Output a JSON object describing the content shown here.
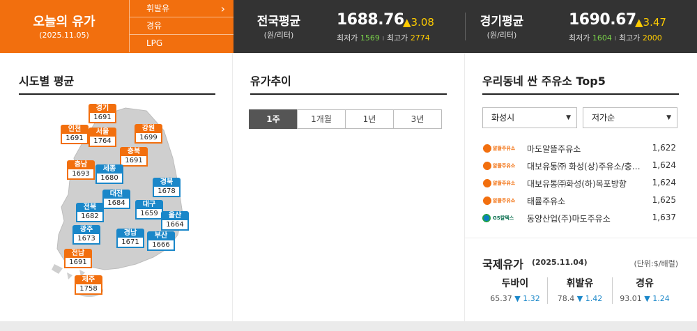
{
  "today": {
    "title": "오늘의 유가",
    "date": "(2025.11.05)"
  },
  "fuel_tabs": [
    "휘발유",
    "경유",
    "LPG"
  ],
  "national": {
    "name": "전국평균",
    "unit": "(원/리터)",
    "price": "1688.76",
    "change": "▲3.08",
    "min_label": "최저가",
    "min": "1569",
    "max_label": "최고가",
    "max": "2774"
  },
  "gyeonggi": {
    "name": "경기평균",
    "unit": "(원/리터)",
    "price": "1690.67",
    "change": "▲3.47",
    "min_label": "최저가",
    "min": "1604",
    "max_label": "최고가",
    "max": "2000"
  },
  "regional": {
    "title": "시도별 평균",
    "regions": [
      {
        "name": "경기",
        "value": "1691",
        "color": "orange"
      },
      {
        "name": "인천",
        "value": "1691",
        "color": "orange"
      },
      {
        "name": "서울",
        "value": "1764",
        "color": "orange"
      },
      {
        "name": "강원",
        "value": "1699",
        "color": "orange"
      },
      {
        "name": "충북",
        "value": "1691",
        "color": "orange"
      },
      {
        "name": "충남",
        "value": "1693",
        "color": "orange"
      },
      {
        "name": "세종",
        "value": "1680",
        "color": "blue"
      },
      {
        "name": "경북",
        "value": "1678",
        "color": "blue"
      },
      {
        "name": "대전",
        "value": "1684",
        "color": "blue"
      },
      {
        "name": "전북",
        "value": "1682",
        "color": "blue"
      },
      {
        "name": "대구",
        "value": "1659",
        "color": "blue"
      },
      {
        "name": "울산",
        "value": "1664",
        "color": "blue"
      },
      {
        "name": "광주",
        "value": "1673",
        "color": "blue"
      },
      {
        "name": "경남",
        "value": "1671",
        "color": "blue"
      },
      {
        "name": "부산",
        "value": "1666",
        "color": "blue"
      },
      {
        "name": "전남",
        "value": "1691",
        "color": "orange"
      },
      {
        "name": "제주",
        "value": "1758",
        "color": "orange"
      }
    ]
  },
  "trend": {
    "title": "유가추이",
    "periods": [
      "1주",
      "1개월",
      "1년",
      "3년"
    ],
    "selected": "1주"
  },
  "top5": {
    "title": "우리동네 싼 주유소 Top5",
    "city": "화성시",
    "sort": "저가순",
    "stations": [
      {
        "brand": "알뜰주유소",
        "name": "마도알뜰주유소",
        "price": "1,622"
      },
      {
        "brand": "알뜰주유소",
        "name": "대보유통㈜ 화성(상)주유소/충…",
        "price": "1,624"
      },
      {
        "brand": "알뜰주유소",
        "name": "대보유통㈜화성(하)목포방향",
        "price": "1,624"
      },
      {
        "brand": "알뜰주유소",
        "name": "태률주유소",
        "price": "1,625"
      },
      {
        "brand": "GS칼텍스",
        "name": "동양산업(주)마도주유소",
        "price": "1,637"
      }
    ]
  },
  "intl": {
    "title": "국제유가",
    "date": "(2025.11.04)",
    "unit": "(단위:$/배럴)",
    "oils": [
      {
        "name": "두바이",
        "value": "65.37",
        "change": "▼ 1.32"
      },
      {
        "name": "휘발유",
        "value": "78.4",
        "change": "▼ 1.42"
      },
      {
        "name": "경유",
        "value": "93.01",
        "change": "▼ 1.24"
      }
    ]
  },
  "colors": {
    "orange": "#f26f0e",
    "dark": "#333333",
    "blue": "#1a87c9"
  }
}
